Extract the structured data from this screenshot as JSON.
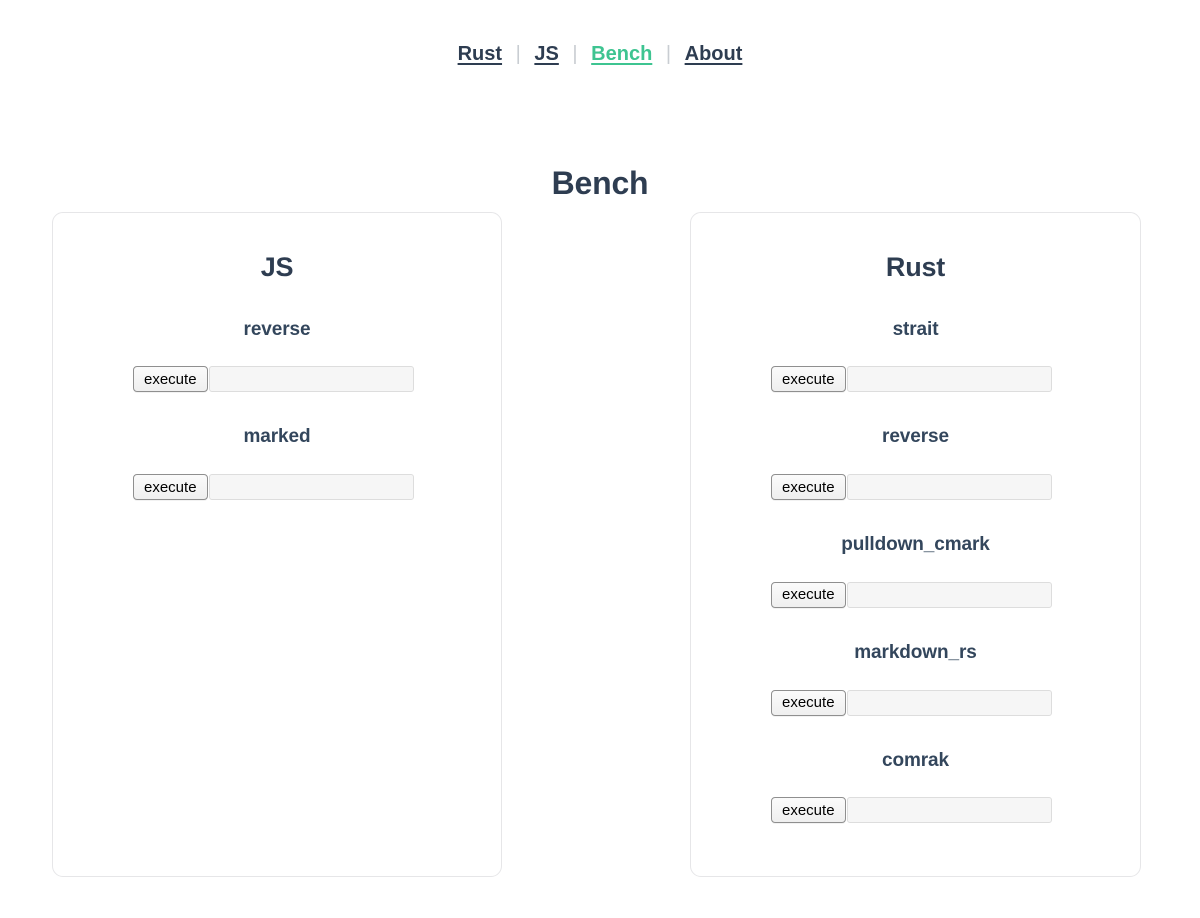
{
  "nav": {
    "separator": "|",
    "items": [
      {
        "label": "Rust",
        "active": false
      },
      {
        "label": "JS",
        "active": false
      },
      {
        "label": "Bench",
        "active": true
      },
      {
        "label": "About",
        "active": false
      }
    ],
    "active_color": "#3ec491",
    "link_color": "#2e3d51"
  },
  "page": {
    "title": "Bench"
  },
  "cards": [
    {
      "title": "JS",
      "sections": [
        {
          "name": "reverse",
          "button_label": "execute",
          "result_value": "",
          "result_placeholder": ""
        },
        {
          "name": "marked",
          "button_label": "execute",
          "result_value": "",
          "result_placeholder": ""
        }
      ]
    },
    {
      "title": "Rust",
      "sections": [
        {
          "name": "strait",
          "button_label": "execute",
          "result_value": "",
          "result_placeholder": ""
        },
        {
          "name": "reverse",
          "button_label": "execute",
          "result_value": "",
          "result_placeholder": ""
        },
        {
          "name": "pulldown_cmark",
          "button_label": "execute",
          "result_value": "",
          "result_placeholder": ""
        },
        {
          "name": "markdown_rs",
          "button_label": "execute",
          "result_value": "",
          "result_placeholder": ""
        },
        {
          "name": "comrak",
          "button_label": "execute",
          "result_value": "",
          "result_placeholder": ""
        }
      ]
    }
  ]
}
